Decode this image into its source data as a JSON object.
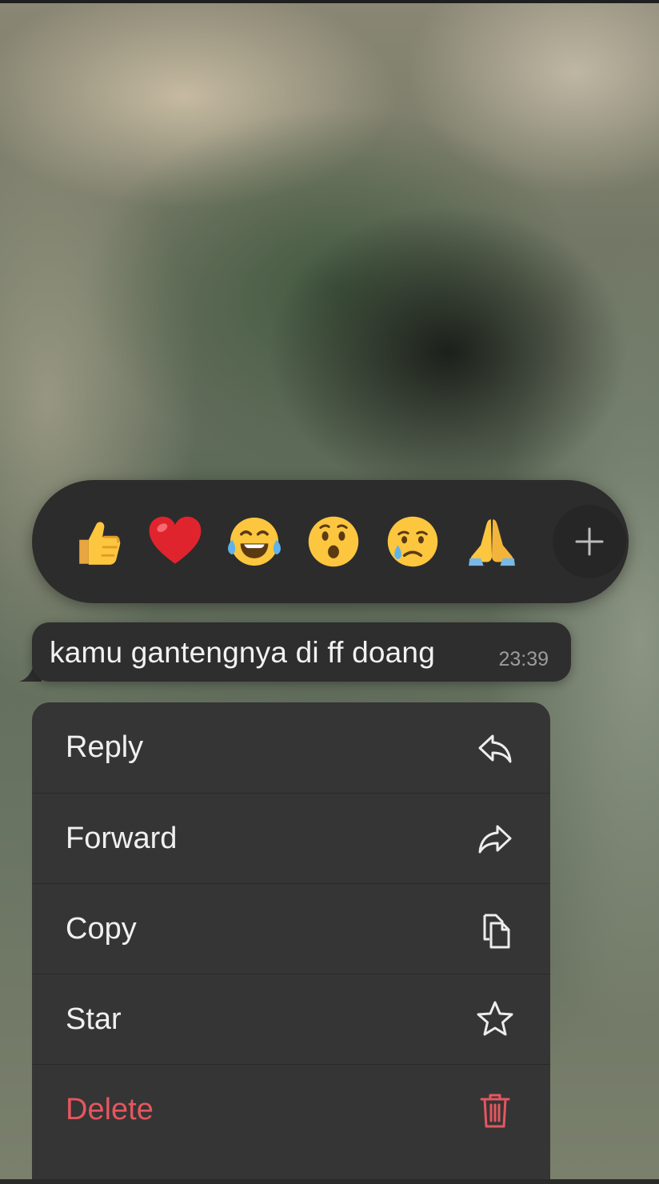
{
  "reactions": {
    "emojis": [
      {
        "icon": "thumbs-up-icon",
        "label": "👍"
      },
      {
        "icon": "red-heart-icon",
        "label": "❤️"
      },
      {
        "icon": "tears-of-joy-icon",
        "label": "😂"
      },
      {
        "icon": "surprised-face-icon",
        "label": "😮"
      },
      {
        "icon": "crying-face-icon",
        "label": "😢"
      },
      {
        "icon": "folded-hands-icon",
        "label": "🙏"
      }
    ],
    "more_icon": "plus-icon"
  },
  "message": {
    "text": "kamu gantengnya di ff doang",
    "time": "23:39"
  },
  "menu": {
    "items": [
      {
        "label": "Reply",
        "icon": "reply-icon"
      },
      {
        "label": "Forward",
        "icon": "forward-icon"
      },
      {
        "label": "Copy",
        "icon": "copy-icon"
      },
      {
        "label": "Star",
        "icon": "star-icon"
      },
      {
        "label": "Delete",
        "icon": "trash-icon"
      }
    ]
  },
  "colors": {
    "delete": "#e5565f",
    "menu_bg": "#353535",
    "bubble_bg": "#2e2e2e"
  }
}
